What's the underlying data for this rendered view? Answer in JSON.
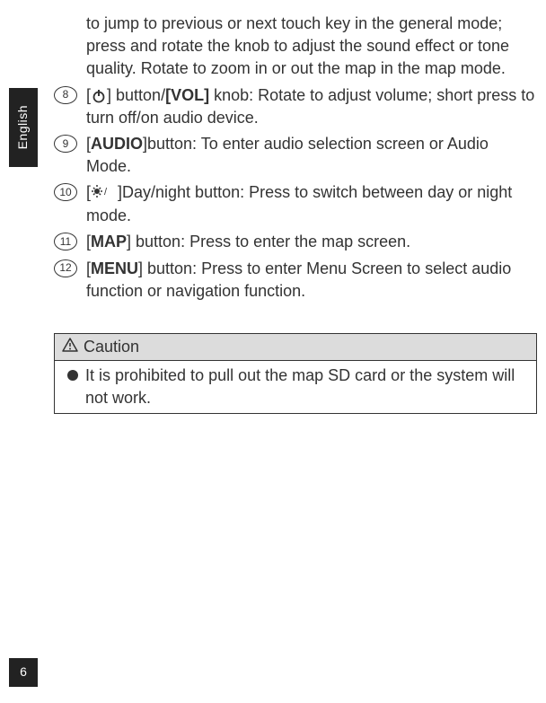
{
  "sideTab": {
    "label": "English"
  },
  "pageNumber": "6",
  "continuation": {
    "text": "to jump to previous or next touch key in the general mode; press and rotate the knob to adjust the sound effect or tone quality. Rotate to zoom in or out the map in the map mode."
  },
  "items": [
    {
      "marker": "8",
      "prefix": "[",
      "icon": "power-icon",
      "afterIcon": "] button/",
      "bold1": "[VOL]",
      "rest": " knob: Rotate to adjust volume; short press to turn off/on audio device."
    },
    {
      "marker": "9",
      "prefix": "[",
      "bold1": "AUDIO",
      "afterBold": "]button: To enter audio selection screen or Audio Mode."
    },
    {
      "marker": "10",
      "prefix": "[",
      "icon": "daynight-icon",
      "afterIcon": "]Day/night button: Press to switch between day or night mode."
    },
    {
      "marker": "11",
      "prefix": "[",
      "bold1": "MAP",
      "afterBold": "] button: Press to enter the map screen."
    },
    {
      "marker": "12",
      "prefix": "[",
      "bold1": "MENU",
      "afterBold": "] button: Press to enter Menu Screen to select audio function or navigation function."
    }
  ],
  "caution": {
    "label": "Caution",
    "text": "It is prohibited to pull out the map SD card or the system will not work."
  }
}
